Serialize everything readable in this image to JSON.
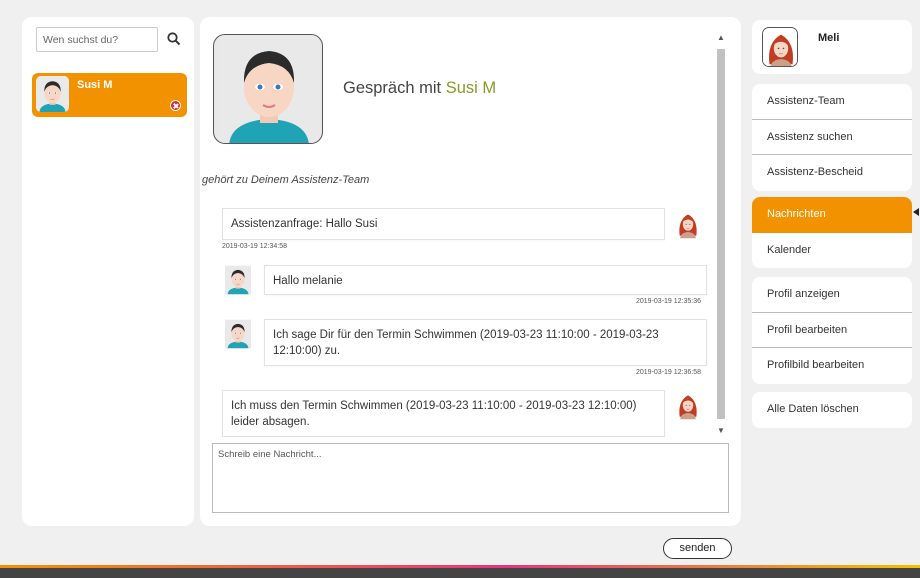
{
  "search": {
    "placeholder": "Wen suchst du?",
    "icon": "search-icon"
  },
  "contacts": [
    {
      "name": "Susi M",
      "status_icon": "remove-icon",
      "status_color": "#d32f2f"
    }
  ],
  "chat": {
    "title_prefix": "Gespräch mit ",
    "title_name": "Susi M",
    "team_note": "gehört zu Deinem Assistenz-Team",
    "messages": [
      {
        "text": "Assistenzanfrage: Hallo Susi",
        "time": "2019-03-19 12:34:58",
        "from": "me"
      },
      {
        "text": "Hallo melanie",
        "time": "2019-03-19 12:35:36",
        "from": "other"
      },
      {
        "text": "Ich sage Dir für den Termin Schwimmen (2019-03-23 11:10:00 - 2019-03-23 12:10:00) zu.",
        "time": "2019-03-19 12:36:58",
        "from": "other"
      },
      {
        "text": "Ich muss den Termin Schwimmen (2019-03-23 11:10:00 - 2019-03-23 12:10:00) leider absagen.",
        "time": "",
        "from": "me"
      }
    ],
    "compose_placeholder": "Schreib eine Nachricht...",
    "send_label": "senden"
  },
  "profile": {
    "name": "Meli"
  },
  "menu": {
    "group1": [
      "Assistenz-Team",
      "Assistenz suchen",
      "Assistenz-Bescheid"
    ],
    "group2": [
      "Nachrichten",
      "Kalender"
    ],
    "group3": [
      "Profil anzeigen",
      "Profil bearbeiten",
      "Profilbild bearbeiten"
    ],
    "group4": [
      "Alle Daten löschen"
    ],
    "active": "Nachrichten"
  },
  "colors": {
    "accent": "#f39200",
    "highlight_name": "#8a9a2a",
    "footer": "#444444"
  }
}
